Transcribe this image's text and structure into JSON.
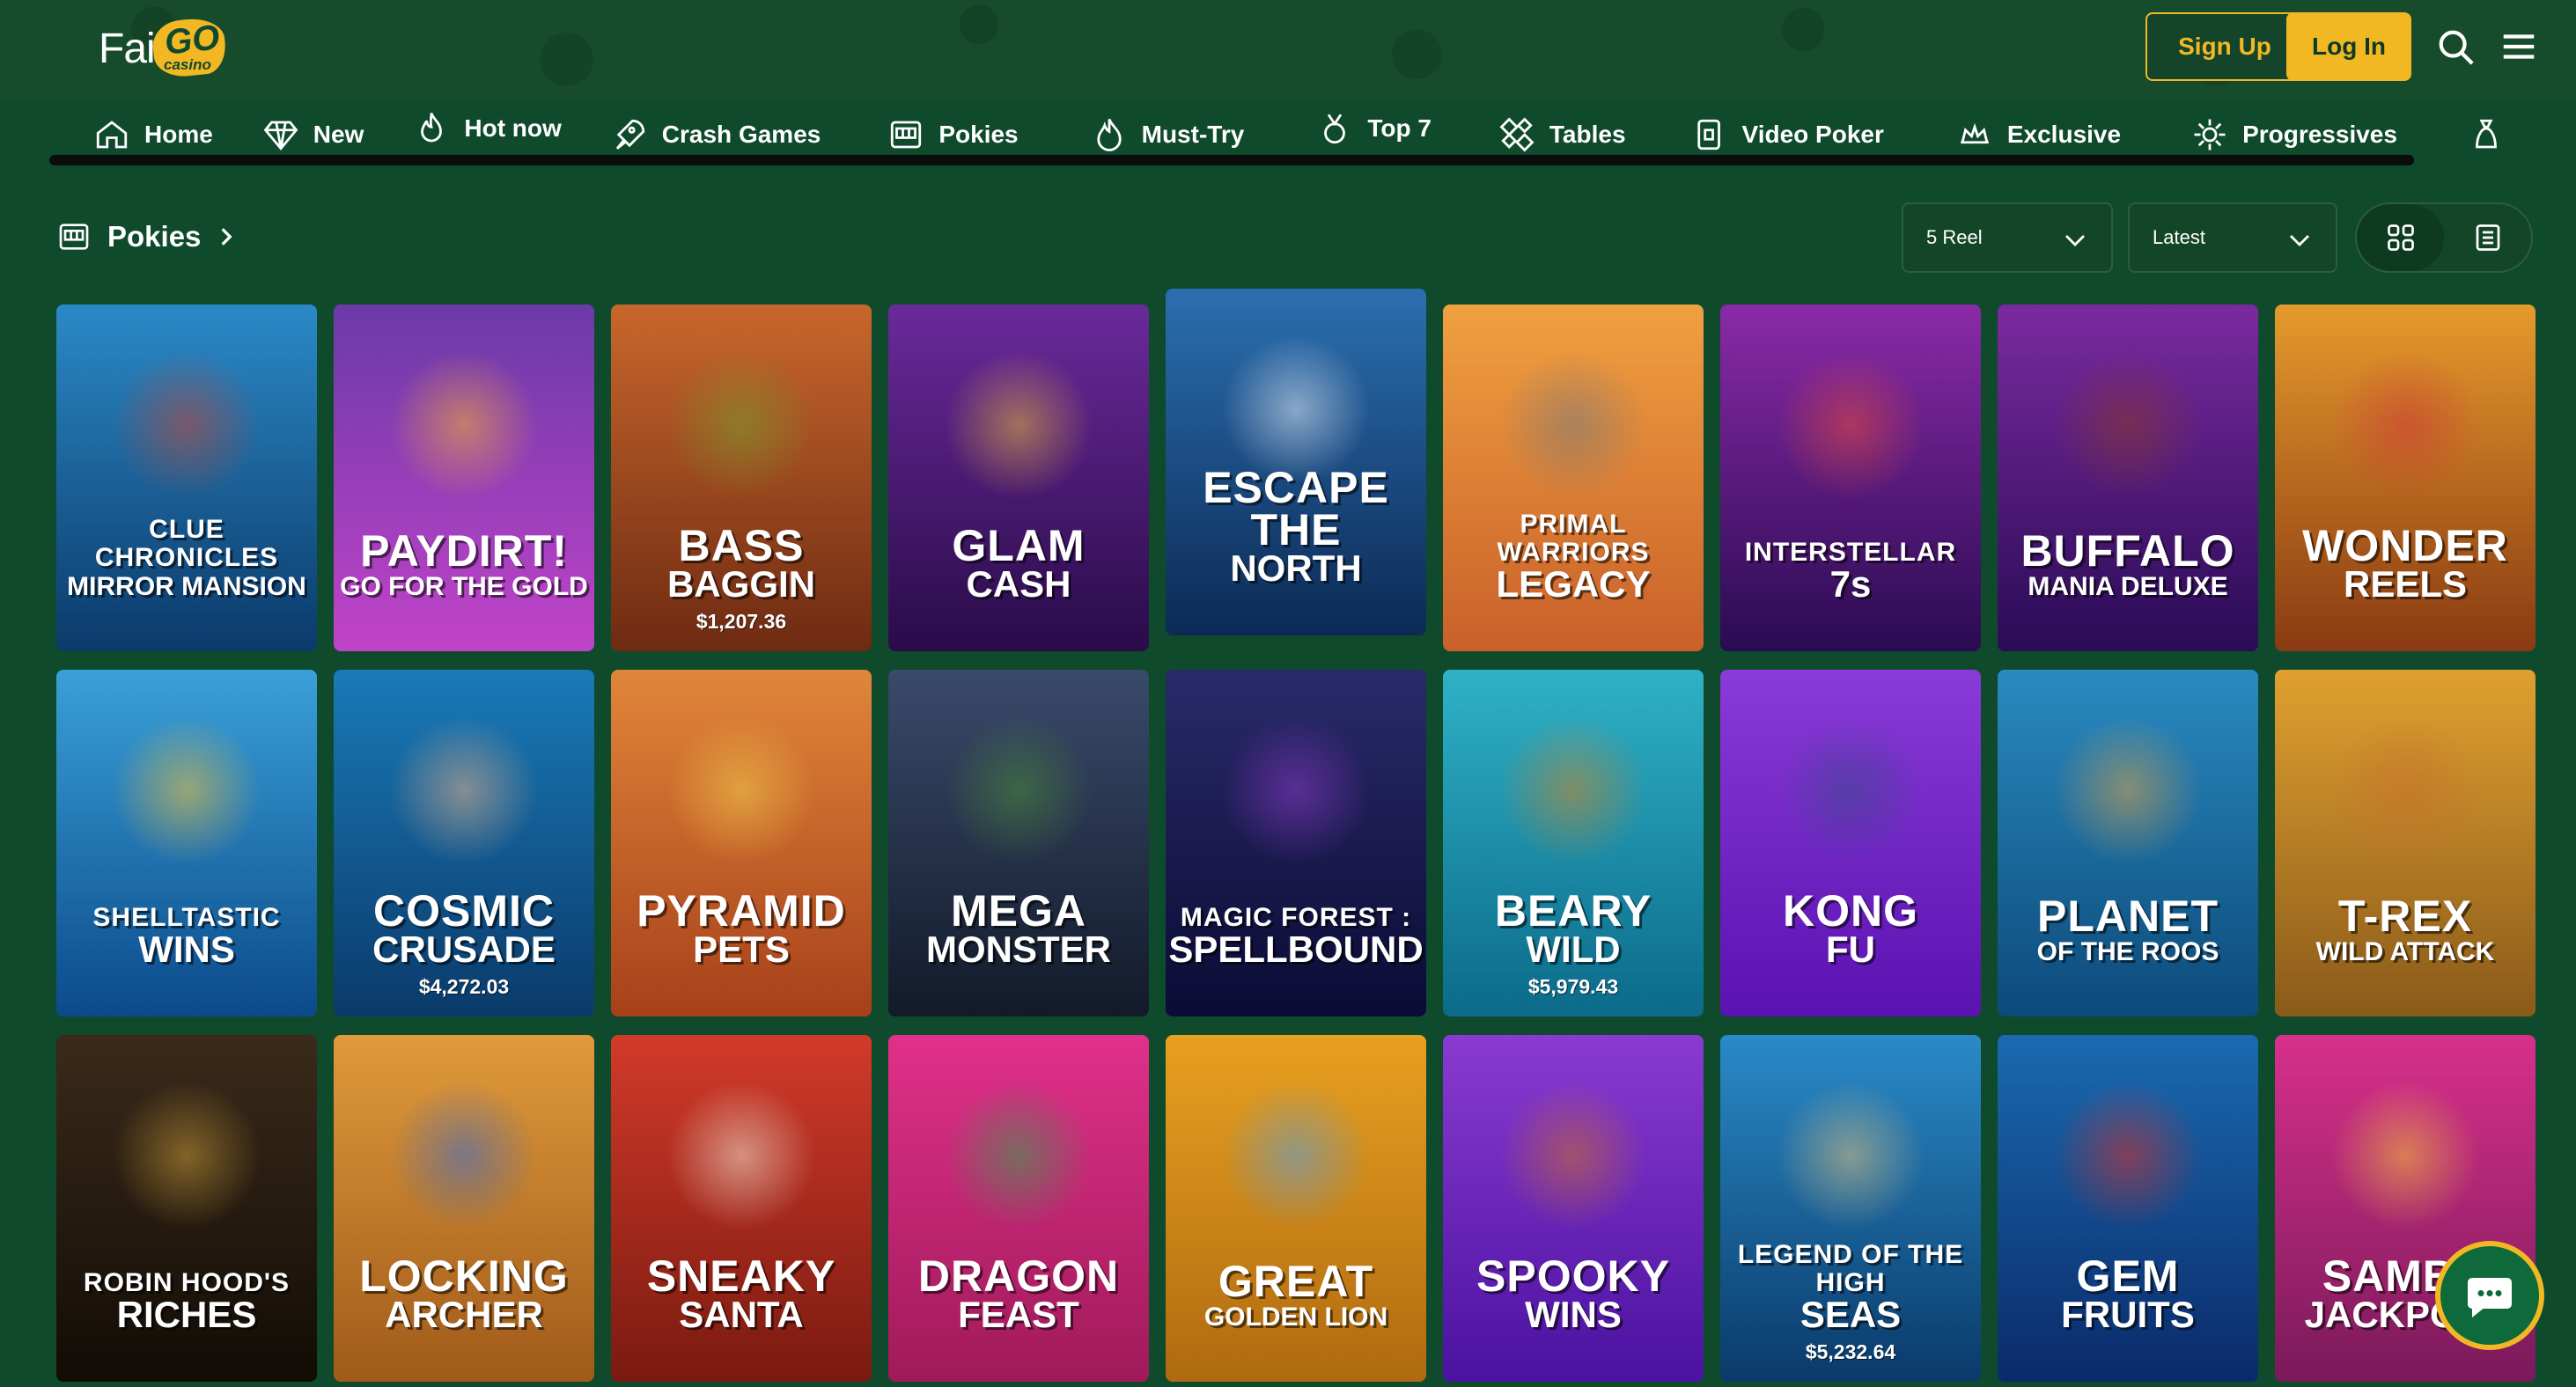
{
  "brand": {
    "logo_fair": "Fair",
    "logo_go": "GO",
    "logo_casino": "casino"
  },
  "header": {
    "signup_label": "Sign Up",
    "login_label": "Log In"
  },
  "nav": [
    {
      "label": "Home",
      "icon": "home-icon"
    },
    {
      "label": "New",
      "icon": "diamond-icon"
    },
    {
      "label": "Hot now",
      "icon": "flame-icon"
    },
    {
      "label": "Crash Games",
      "icon": "rocket-icon"
    },
    {
      "label": "Pokies",
      "icon": "slot-machine-icon"
    },
    {
      "label": "Must-Try",
      "icon": "fire-icon"
    },
    {
      "label": "Top 7",
      "icon": "medal-icon"
    },
    {
      "label": "Tables",
      "icon": "cards-icon"
    },
    {
      "label": "Video Poker",
      "icon": "poker-icon"
    },
    {
      "label": "Exclusive",
      "icon": "crown-icon"
    },
    {
      "label": "Progressives",
      "icon": "progressive-icon"
    }
  ],
  "section": {
    "title": "Pokies"
  },
  "filters": {
    "reel": "5 Reel",
    "sort": "Latest"
  },
  "games": [
    {
      "line1": "CLUE CHRONICLES",
      "line2": "MIRROR MANSION",
      "jackpot": "",
      "c1": "#2b89c7",
      "c2": "#0b3a6a",
      "art": "#c0493a"
    },
    {
      "line1": "PAYDIRT!",
      "line2": "GO FOR THE GOLD",
      "jackpot": "",
      "c1": "#6b3aa8",
      "c2": "#c043c8",
      "art": "#f5b132"
    },
    {
      "line1": "BASS",
      "line2": "BAGGIN",
      "jackpot": "$1,207.36",
      "c1": "#c8672c",
      "c2": "#6e2a12",
      "art": "#7a9a2c"
    },
    {
      "line1": "GLAM",
      "line2": "CASH",
      "jackpot": "",
      "c1": "#6a2a9a",
      "c2": "#2a0b4a",
      "art": "#e5b240"
    },
    {
      "line1": "ESCAPE THE",
      "line2": "NORTH",
      "jackpot": "",
      "c1": "#2b6fb0",
      "c2": "#0c2a55",
      "art": "#dfe8f6"
    },
    {
      "line1": "PRIMAL WARRIORS",
      "line2": "LEGACY",
      "jackpot": "",
      "c1": "#f0a040",
      "c2": "#c9602a",
      "art": "#7a7a7a"
    },
    {
      "line1": "INTERSTELLAR",
      "line2": "7s",
      "jackpot": "",
      "c1": "#8a2aa8",
      "c2": "#2a0b52",
      "art": "#e14a3a"
    },
    {
      "line1": "BUFFALO",
      "line2": "MANIA DELUXE",
      "jackpot": "",
      "c1": "#7a2aa0",
      "c2": "#2a0b55",
      "art": "#8a3a2a"
    },
    {
      "line1": "WONDER",
      "line2": "REELS",
      "jackpot": "",
      "c1": "#e59a2c",
      "c2": "#8a3a12",
      "art": "#d13a3a"
    },
    {
      "line1": "SHELLTASTIC",
      "line2": "WINS",
      "jackpot": "",
      "c1": "#3aa0d8",
      "c2": "#0b4a8a",
      "art": "#f2c23a"
    },
    {
      "line1": "COSMIC",
      "line2": "CRUSADE",
      "jackpot": "$4,272.03",
      "c1": "#1a7ab8",
      "c2": "#0a3a6a",
      "art": "#e2b08a"
    },
    {
      "line1": "PYRAMID",
      "line2": "PETS",
      "jackpot": "",
      "c1": "#e0863a",
      "c2": "#a7401a",
      "art": "#f2c84a"
    },
    {
      "line1": "MEGA",
      "line2": "MONSTER",
      "jackpot": "",
      "c1": "#3a4a6a",
      "c2": "#121a2a",
      "art": "#4a8a3a"
    },
    {
      "line1": "MAGIC FOREST :",
      "line2": "SPELLBOUND",
      "jackpot": "",
      "c1": "#2a2a6a",
      "c2": "#0b0b35",
      "art": "#8a3ac8"
    },
    {
      "line1": "BEARY",
      "line2": "WILD",
      "jackpot": "$5,979.43",
      "c1": "#2fb1c6",
      "c2": "#0b6a8a",
      "art": "#c8862a"
    },
    {
      "line1": "KONG",
      "line2": "FU",
      "jackpot": "",
      "c1": "#8a3ad8",
      "c2": "#5a12b0",
      "art": "#3a4a8a"
    },
    {
      "line1": "PLANET",
      "line2": "OF THE ROOS",
      "jackpot": "",
      "c1": "#2a8ac0",
      "c2": "#0c4a7a",
      "art": "#d8a24a"
    },
    {
      "line1": "T-REX",
      "line2": "WILD ATTACK",
      "jackpot": "",
      "c1": "#e0a030",
      "c2": "#8a5a1a",
      "art": "#c8702a"
    },
    {
      "line1": "ROBIN HOOD'S",
      "line2": "RICHES",
      "jackpot": "",
      "c1": "#3a2a1a",
      "c2": "#120c06",
      "art": "#c89a3a"
    },
    {
      "line1": "LOCKING",
      "line2": "ARCHER",
      "jackpot": "",
      "c1": "#e09a3a",
      "c2": "#a05a1a",
      "art": "#3a6ac8"
    },
    {
      "line1": "SNEAKY",
      "line2": "SANTA",
      "jackpot": "",
      "c1": "#d23a2a",
      "c2": "#7a1a10",
      "art": "#f0e0d0"
    },
    {
      "line1": "DRAGON",
      "line2": "FEAST",
      "jackpot": "",
      "c1": "#e0308a",
      "c2": "#a01a5a",
      "art": "#3aa04a"
    },
    {
      "line1": "GREAT",
      "line2": "GOLDEN LION",
      "jackpot": "",
      "c1": "#e8a020",
      "c2": "#b06a10",
      "art": "#5aa0d8"
    },
    {
      "line1": "SPOOKY",
      "line2": "WINS",
      "jackpot": "",
      "c1": "#8a3ad0",
      "c2": "#4a12a0",
      "art": "#c8702a"
    },
    {
      "line1": "LEGEND OF THE HIGH",
      "line2": "SEAS",
      "jackpot": "$5,232.64",
      "c1": "#2a8ac8",
      "c2": "#0a3a6a",
      "art": "#d8c080"
    },
    {
      "line1": "GEM",
      "line2": "FRUITS",
      "jackpot": "",
      "c1": "#1a6ab0",
      "c2": "#0a2a6a",
      "art": "#d8302a"
    },
    {
      "line1": "SAMBA",
      "line2": "JACKPOTS",
      "jackpot": "",
      "c1": "#d8308a",
      "c2": "#7a1a5a",
      "art": "#f2c23a"
    }
  ]
}
